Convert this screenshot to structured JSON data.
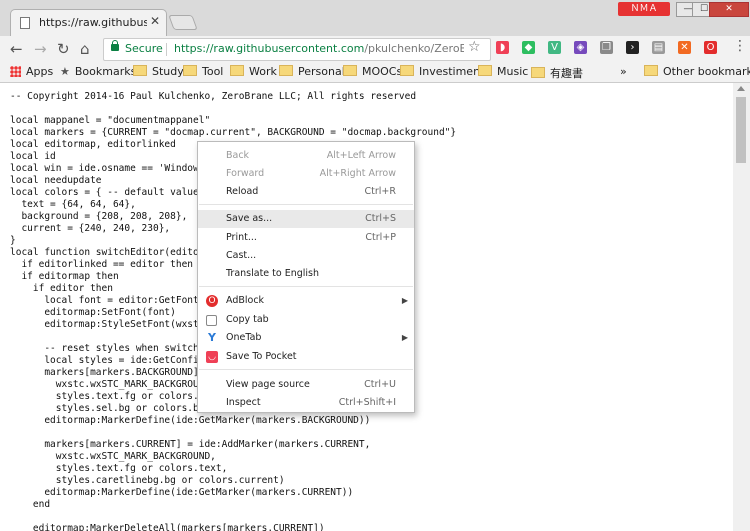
{
  "tab": {
    "title": "https://raw.githubuserco",
    "close": "✕"
  },
  "window": {
    "profile": "ＮＭＡ",
    "minimize": "—",
    "maximize": "☐",
    "close": "✕"
  },
  "nav": {
    "back": "←",
    "forward": "→",
    "reload": "↻",
    "home": "⌂"
  },
  "omnibox": {
    "secure": "Secure",
    "url_host": "https://raw.githubusercontent.com",
    "url_path": "/pkulchenko/ZeroBraneP",
    "star": "☆"
  },
  "extensions": [
    {
      "name": "pocket",
      "glyph": "◗",
      "color": "#ef4056"
    },
    {
      "name": "evernote",
      "glyph": "◆",
      "color": "#2dbe60"
    },
    {
      "name": "vue",
      "glyph": "V",
      "color": "#41b883"
    },
    {
      "name": "redux",
      "glyph": "◈",
      "color": "#764abc"
    },
    {
      "name": "copy",
      "glyph": "❐",
      "color": "#8a8a8a"
    },
    {
      "name": "terminal",
      "glyph": "›",
      "color": "#222222"
    },
    {
      "name": "reader",
      "glyph": "▤",
      "color": "#9a9a9a"
    },
    {
      "name": "blocker",
      "glyph": "✕",
      "color": "#f26a22"
    },
    {
      "name": "adblock",
      "glyph": "O",
      "color": "#e32d2d"
    }
  ],
  "bookmarks": {
    "apps": "Apps",
    "items": [
      "Bookmarks",
      "Study",
      "Tool",
      "Work",
      "Personal",
      "MOOCs",
      "Investiment",
      "Music",
      "有趣書"
    ],
    "more": "»",
    "other": "Other bookmarks"
  },
  "code": "-- Copyright 2014-16 Paul Kulchenko, ZeroBrane LLC; All rights reserved\n\nlocal mappanel = \"documentmappanel\"\nlocal markers = {CURRENT = \"docmap.current\", BACKGROUND = \"docmap.background\"}\nlocal editormap, editorlinked\nlocal id\nlocal win = ide.osname == 'Window\nlocal needupdate\nlocal colors = { -- default value\n  text = {64, 64, 64},\n  background = {208, 208, 208},\n  current = {240, 240, 230},\n}\nlocal function switchEditor(edito\n  if editorlinked == editor then\n  if editormap then\n    if editor then\n      local font = editor:GetFont\n      editormap:SetFont(font)\n      editormap:StyleSetFont(wxst\n\n      -- reset styles when switch\n      local styles = ide:GetConfi\n      markers[markers.BACKGROUND]\n        wxstc.wxSTC_MARK_BACKGROU\n        styles.text.fg or colors.\n        styles.sel.bg or colors.b\n      editormap:MarkerDefine(ide:GetMarker(markers.BACKGROUND))\n\n      markers[markers.CURRENT] = ide:AddMarker(markers.CURRENT,\n        wxstc.wxSTC_MARK_BACKGROUND,\n        styles.text.fg or colors.text,\n        styles.caretlinebg.bg or colors.current)\n      editormap:MarkerDefine(ide:GetMarker(markers.CURRENT))\n    end\n\n    editormap:MarkerDeleteAll(markers[markers.CURRENT])",
  "context_menu": {
    "back": {
      "label": "Back",
      "shortcut": "Alt+Left Arrow"
    },
    "forward": {
      "label": "Forward",
      "shortcut": "Alt+Right Arrow"
    },
    "reload": {
      "label": "Reload",
      "shortcut": "Ctrl+R"
    },
    "save_as": {
      "label": "Save as...",
      "shortcut": "Ctrl+S"
    },
    "print": {
      "label": "Print...",
      "shortcut": "Ctrl+P"
    },
    "cast": {
      "label": "Cast..."
    },
    "translate": {
      "label": "Translate to English"
    },
    "adblock": {
      "label": "AdBlock"
    },
    "copy_tab": {
      "label": "Copy tab"
    },
    "onetab": {
      "label": "OneTab"
    },
    "save_to_pocket": {
      "label": "Save To Pocket"
    },
    "view_source": {
      "label": "View page source",
      "shortcut": "Ctrl+U"
    },
    "inspect": {
      "label": "Inspect",
      "shortcut": "Ctrl+Shift+I"
    }
  }
}
